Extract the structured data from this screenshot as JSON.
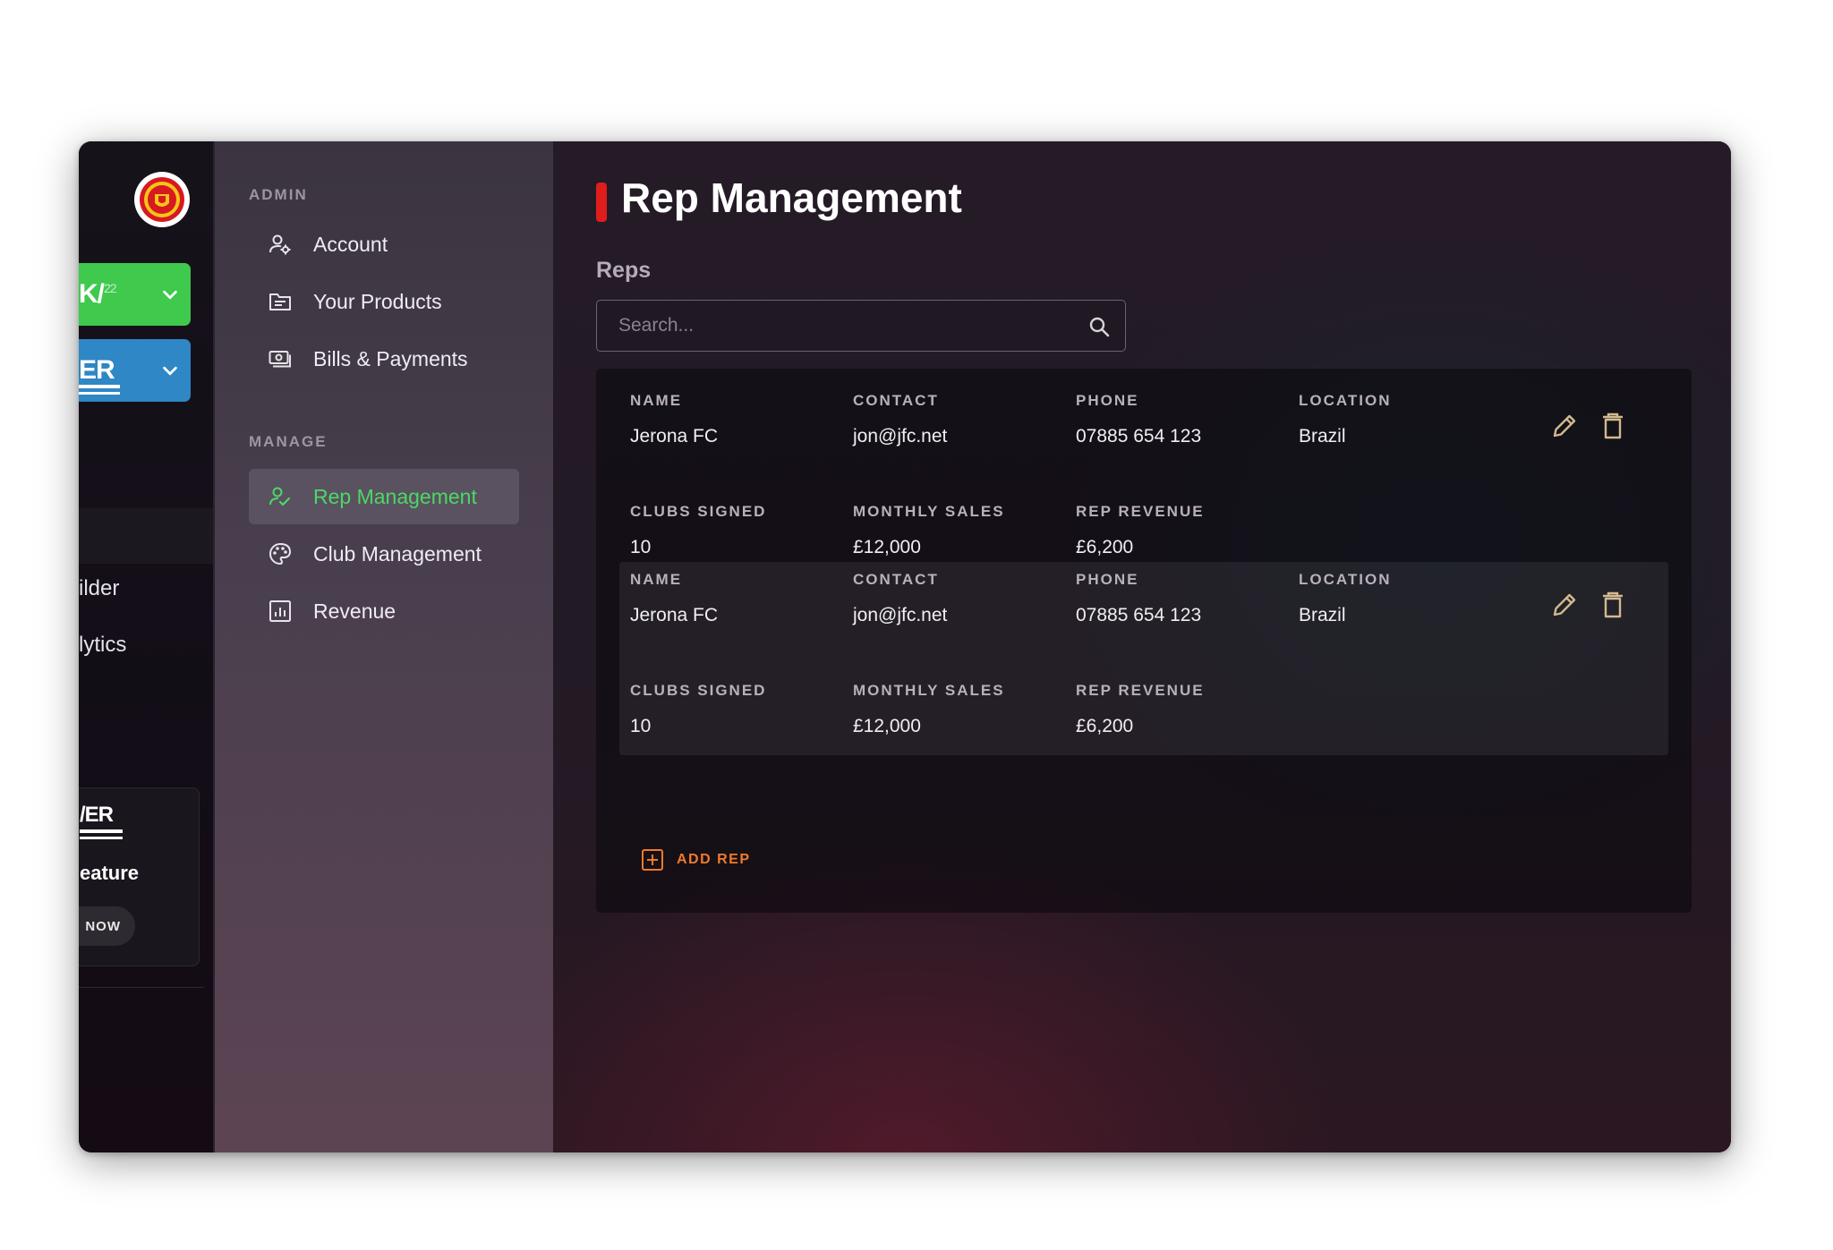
{
  "rail": {
    "select_1_text": "K/",
    "select_1_sup": "22",
    "select_2_text": "ER",
    "items": [
      "ilder",
      "lytics"
    ],
    "promo": {
      "logo_text": "/ER",
      "title": "eature",
      "button": "NOW"
    }
  },
  "nav": {
    "sections": [
      {
        "label": "ADMIN",
        "items": [
          {
            "label": "Account",
            "icon": "user-gear-icon"
          },
          {
            "label": "Your Products",
            "icon": "folder-icon"
          },
          {
            "label": "Bills & Payments",
            "icon": "cash-icon"
          }
        ]
      },
      {
        "label": "MANAGE",
        "items": [
          {
            "label": "Rep Management",
            "icon": "person-check-icon",
            "active": true
          },
          {
            "label": "Club Management",
            "icon": "palette-icon"
          },
          {
            "label": "Revenue",
            "icon": "bar-chart-icon"
          }
        ]
      }
    ]
  },
  "main": {
    "title": "Rep Management",
    "section_label": "Reps",
    "search": {
      "placeholder": "Search..."
    },
    "columns": {
      "name": "NAME",
      "contact": "CONTACT",
      "phone": "PHONE",
      "location": "LOCATION",
      "clubs_signed": "CLUBS SIGNED",
      "monthly_sales": "MONTHLY SALES",
      "rep_revenue": "REP REVENUE"
    },
    "reps": [
      {
        "name": "Jerona FC",
        "contact": "jon@jfc.net",
        "phone": "07885 654 123",
        "location": "Brazil",
        "clubs_signed": "10",
        "monthly_sales": "£12,000",
        "rep_revenue": "£6,200"
      },
      {
        "name": "Jerona FC",
        "contact": "jon@jfc.net",
        "phone": "07885 654 123",
        "location": "Brazil",
        "clubs_signed": "10",
        "monthly_sales": "£12,000",
        "rep_revenue": "£6,200"
      }
    ],
    "add_rep_label": "ADD REP"
  },
  "colors": {
    "accent_green": "#4cd866",
    "title_marker_red": "#e01c1c",
    "add_rep_orange": "#f07a2a",
    "select_green": "#3fc94d",
    "select_blue": "#2f87c5"
  }
}
